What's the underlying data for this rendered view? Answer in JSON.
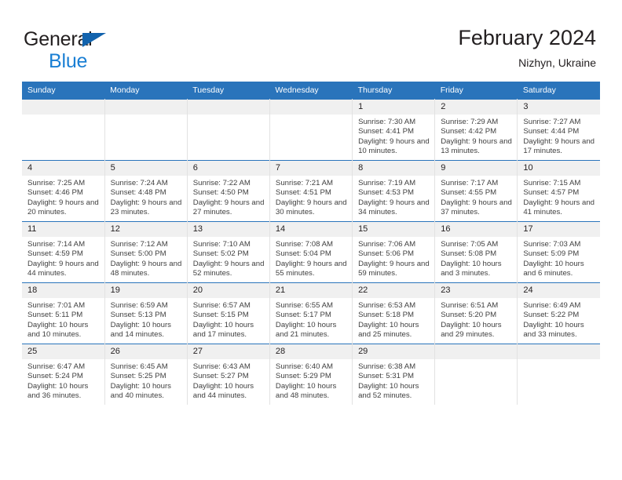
{
  "brand": {
    "line1": "General",
    "line2": "Blue",
    "triangle_color": "#1263ad",
    "blue_color": "#1a7fd4"
  },
  "header": {
    "title": "February 2024",
    "subtitle": "Nizhyn, Ukraine"
  },
  "theme": {
    "header_bg": "#2a74bb",
    "daynum_bg": "#f0f0f0",
    "text": "#231f20",
    "body_text": "#404040",
    "cell_border": "#e2e2e2"
  },
  "weekday_headers": [
    "Sunday",
    "Monday",
    "Tuesday",
    "Wednesday",
    "Thursday",
    "Friday",
    "Saturday"
  ],
  "labels": {
    "sunrise_prefix": "Sunrise:",
    "sunset_prefix": "Sunset:",
    "daylight_prefix": "Daylight:"
  },
  "weeks": [
    [
      {
        "day": "",
        "empty": true
      },
      {
        "day": "",
        "empty": true
      },
      {
        "day": "",
        "empty": true
      },
      {
        "day": "",
        "empty": true
      },
      {
        "day": "1",
        "sunrise": "Sunrise: 7:30 AM",
        "sunset": "Sunset: 4:41 PM",
        "daylight": "Daylight: 9 hours and 10 minutes."
      },
      {
        "day": "2",
        "sunrise": "Sunrise: 7:29 AM",
        "sunset": "Sunset: 4:42 PM",
        "daylight": "Daylight: 9 hours and 13 minutes."
      },
      {
        "day": "3",
        "sunrise": "Sunrise: 7:27 AM",
        "sunset": "Sunset: 4:44 PM",
        "daylight": "Daylight: 9 hours and 17 minutes."
      }
    ],
    [
      {
        "day": "4",
        "sunrise": "Sunrise: 7:25 AM",
        "sunset": "Sunset: 4:46 PM",
        "daylight": "Daylight: 9 hours and 20 minutes."
      },
      {
        "day": "5",
        "sunrise": "Sunrise: 7:24 AM",
        "sunset": "Sunset: 4:48 PM",
        "daylight": "Daylight: 9 hours and 23 minutes."
      },
      {
        "day": "6",
        "sunrise": "Sunrise: 7:22 AM",
        "sunset": "Sunset: 4:50 PM",
        "daylight": "Daylight: 9 hours and 27 minutes."
      },
      {
        "day": "7",
        "sunrise": "Sunrise: 7:21 AM",
        "sunset": "Sunset: 4:51 PM",
        "daylight": "Daylight: 9 hours and 30 minutes."
      },
      {
        "day": "8",
        "sunrise": "Sunrise: 7:19 AM",
        "sunset": "Sunset: 4:53 PM",
        "daylight": "Daylight: 9 hours and 34 minutes."
      },
      {
        "day": "9",
        "sunrise": "Sunrise: 7:17 AM",
        "sunset": "Sunset: 4:55 PM",
        "daylight": "Daylight: 9 hours and 37 minutes."
      },
      {
        "day": "10",
        "sunrise": "Sunrise: 7:15 AM",
        "sunset": "Sunset: 4:57 PM",
        "daylight": "Daylight: 9 hours and 41 minutes."
      }
    ],
    [
      {
        "day": "11",
        "sunrise": "Sunrise: 7:14 AM",
        "sunset": "Sunset: 4:59 PM",
        "daylight": "Daylight: 9 hours and 44 minutes."
      },
      {
        "day": "12",
        "sunrise": "Sunrise: 7:12 AM",
        "sunset": "Sunset: 5:00 PM",
        "daylight": "Daylight: 9 hours and 48 minutes."
      },
      {
        "day": "13",
        "sunrise": "Sunrise: 7:10 AM",
        "sunset": "Sunset: 5:02 PM",
        "daylight": "Daylight: 9 hours and 52 minutes."
      },
      {
        "day": "14",
        "sunrise": "Sunrise: 7:08 AM",
        "sunset": "Sunset: 5:04 PM",
        "daylight": "Daylight: 9 hours and 55 minutes."
      },
      {
        "day": "15",
        "sunrise": "Sunrise: 7:06 AM",
        "sunset": "Sunset: 5:06 PM",
        "daylight": "Daylight: 9 hours and 59 minutes."
      },
      {
        "day": "16",
        "sunrise": "Sunrise: 7:05 AM",
        "sunset": "Sunset: 5:08 PM",
        "daylight": "Daylight: 10 hours and 3 minutes."
      },
      {
        "day": "17",
        "sunrise": "Sunrise: 7:03 AM",
        "sunset": "Sunset: 5:09 PM",
        "daylight": "Daylight: 10 hours and 6 minutes."
      }
    ],
    [
      {
        "day": "18",
        "sunrise": "Sunrise: 7:01 AM",
        "sunset": "Sunset: 5:11 PM",
        "daylight": "Daylight: 10 hours and 10 minutes."
      },
      {
        "day": "19",
        "sunrise": "Sunrise: 6:59 AM",
        "sunset": "Sunset: 5:13 PM",
        "daylight": "Daylight: 10 hours and 14 minutes."
      },
      {
        "day": "20",
        "sunrise": "Sunrise: 6:57 AM",
        "sunset": "Sunset: 5:15 PM",
        "daylight": "Daylight: 10 hours and 17 minutes."
      },
      {
        "day": "21",
        "sunrise": "Sunrise: 6:55 AM",
        "sunset": "Sunset: 5:17 PM",
        "daylight": "Daylight: 10 hours and 21 minutes."
      },
      {
        "day": "22",
        "sunrise": "Sunrise: 6:53 AM",
        "sunset": "Sunset: 5:18 PM",
        "daylight": "Daylight: 10 hours and 25 minutes."
      },
      {
        "day": "23",
        "sunrise": "Sunrise: 6:51 AM",
        "sunset": "Sunset: 5:20 PM",
        "daylight": "Daylight: 10 hours and 29 minutes."
      },
      {
        "day": "24",
        "sunrise": "Sunrise: 6:49 AM",
        "sunset": "Sunset: 5:22 PM",
        "daylight": "Daylight: 10 hours and 33 minutes."
      }
    ],
    [
      {
        "day": "25",
        "sunrise": "Sunrise: 6:47 AM",
        "sunset": "Sunset: 5:24 PM",
        "daylight": "Daylight: 10 hours and 36 minutes."
      },
      {
        "day": "26",
        "sunrise": "Sunrise: 6:45 AM",
        "sunset": "Sunset: 5:25 PM",
        "daylight": "Daylight: 10 hours and 40 minutes."
      },
      {
        "day": "27",
        "sunrise": "Sunrise: 6:43 AM",
        "sunset": "Sunset: 5:27 PM",
        "daylight": "Daylight: 10 hours and 44 minutes."
      },
      {
        "day": "28",
        "sunrise": "Sunrise: 6:40 AM",
        "sunset": "Sunset: 5:29 PM",
        "daylight": "Daylight: 10 hours and 48 minutes."
      },
      {
        "day": "29",
        "sunrise": "Sunrise: 6:38 AM",
        "sunset": "Sunset: 5:31 PM",
        "daylight": "Daylight: 10 hours and 52 minutes."
      },
      {
        "day": "",
        "empty": true
      },
      {
        "day": "",
        "empty": true
      }
    ]
  ]
}
